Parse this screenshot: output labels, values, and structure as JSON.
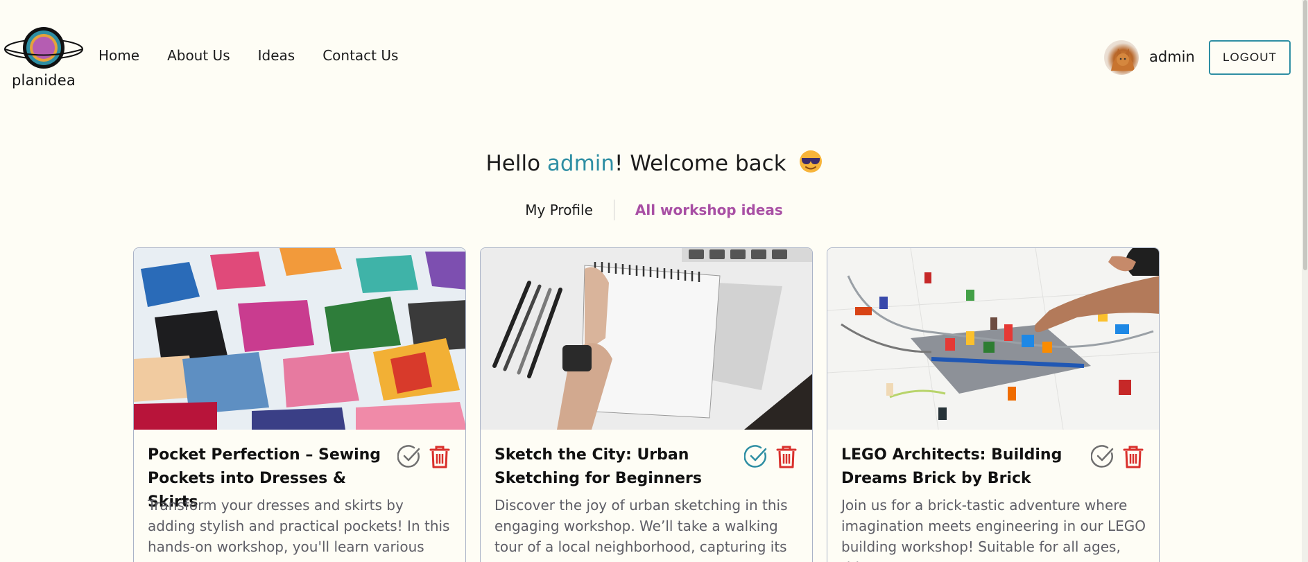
{
  "header": {
    "logo_text": "planidea",
    "nav": [
      "Home",
      "About Us",
      "Ideas",
      "Contact Us"
    ],
    "username": "admin",
    "logout_label": "LOGOUT"
  },
  "greeting": {
    "prefix": "Hello ",
    "name": "admin",
    "suffix": "! Welcome back"
  },
  "tabs": [
    {
      "label": "My Profile",
      "active": false
    },
    {
      "label": "All workshop ideas",
      "active": true
    }
  ],
  "cards": [
    {
      "title": "Pocket Perfection – Sewing Pockets into Dresses & Skirts",
      "description": "Transform your dresses and skirts by adding stylish and practical pockets! In this hands-on workshop, you'll learn various",
      "approved": false
    },
    {
      "title": "Sketch the City: Urban Sketching for Beginners",
      "description": "Discover the joy of urban sketching in this engaging workshop. We’ll take a walking tour of a local neighborhood, capturing its",
      "approved": true
    },
    {
      "title": "LEGO Architects: Building Dreams Brick by Brick",
      "description": "Join us for a brick-tastic adventure where imagination meets engineering in our LEGO building workshop! Suitable for all ages, this",
      "approved": false
    }
  ],
  "colors": {
    "background": "#fefdf5",
    "accent_teal": "#2e8ea3",
    "accent_purple": "#a84fa4",
    "delete_red": "#d9302c",
    "check_gray": "#6f6f6f"
  },
  "icons": {
    "approve": "check-circle-icon",
    "delete": "trash-icon",
    "emoji": "sunglasses-emoji-icon"
  }
}
